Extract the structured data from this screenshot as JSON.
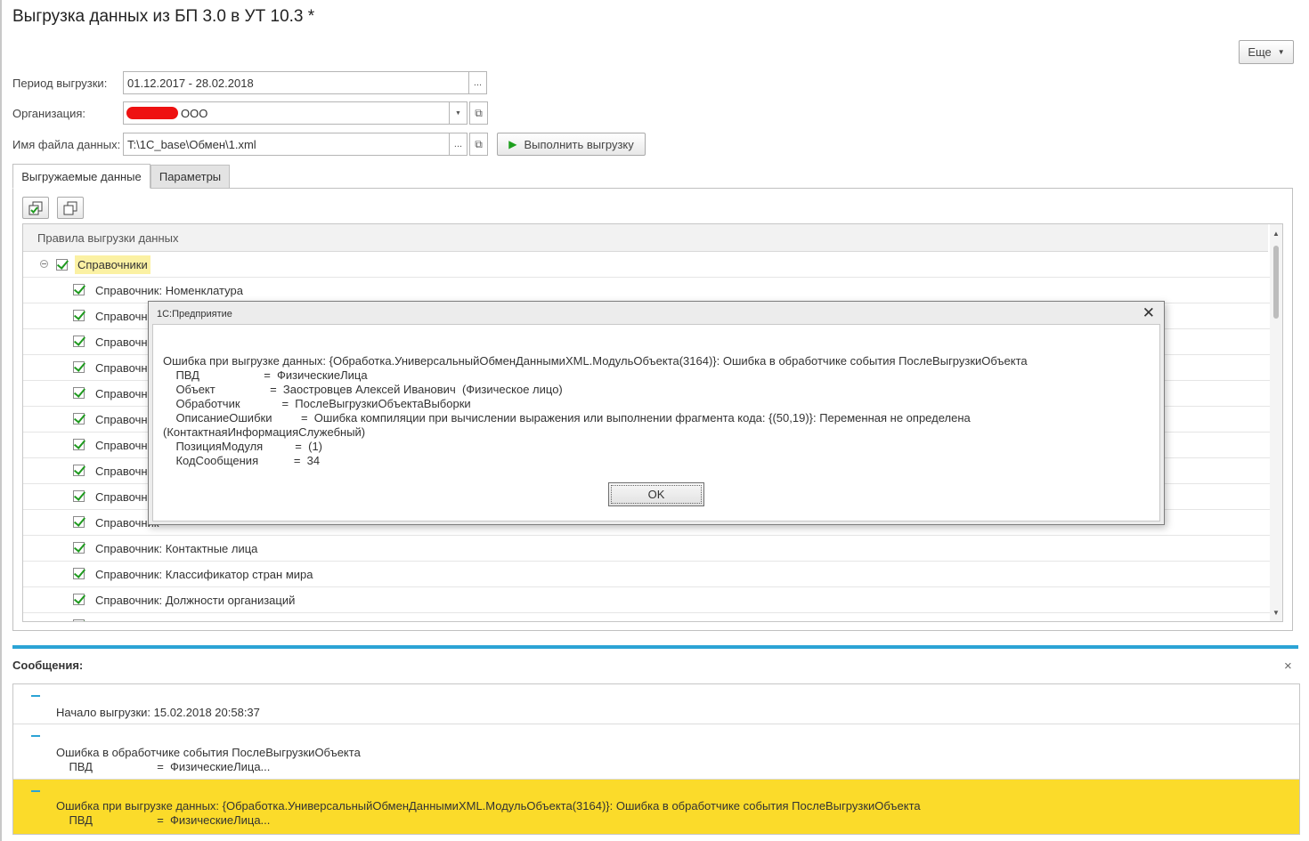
{
  "window": {
    "title": "Выгрузка данных из БП 3.0 в УТ 10.3 *"
  },
  "toolbar": {
    "more_label": "Еще",
    "more_caret": "▼"
  },
  "form": {
    "period_label": "Период выгрузки:",
    "period_value": "01.12.2017 - 28.02.2018",
    "org_label": "Организация:",
    "org_value": "ООО",
    "file_label": "Имя файла данных:",
    "file_value": "T:\\1C_base\\Обмен\\1.xml",
    "ellipsis": "...",
    "dropdown_caret": "▼",
    "open_glyph": "⧉",
    "run_label": "Выполнить выгрузку",
    "run_glyph": "▶"
  },
  "tabs": [
    {
      "label": "Выгружаемые данные",
      "active": true
    },
    {
      "label": "Параметры",
      "active": false
    }
  ],
  "tree": {
    "header": "Правила выгрузки данных",
    "root": "Справочники",
    "items": [
      "Справочник: Номенклатура",
      "Справочник",
      "Справочник",
      "Справочник",
      "Справочник",
      "Справочник",
      "Справочник",
      "Справочник",
      "Справочник",
      "Справочник",
      "Справочник: Контактные лица",
      "Справочник: Классификатор стран мира",
      "Справочник: Должности организаций"
    ]
  },
  "messages": {
    "title": "Сообщения:",
    "close_glyph": "×",
    "items": [
      {
        "lines": [
          "Начало выгрузки: 15.02.2018 20:58:37"
        ],
        "highlighted": false
      },
      {
        "lines": [
          "Ошибка в обработчике события ПослеВыгрузкиОбъекта",
          "    ПВД                    =  ФизическиеЛица..."
        ],
        "highlighted": false
      },
      {
        "lines": [
          "Ошибка при выгрузке данных: {Обработка.УниверсальныйОбменДаннымиXML.МодульОбъекта(3164)}: Ошибка в обработчике события ПослеВыгрузкиОбъекта",
          "    ПВД                    =  ФизическиеЛица..."
        ],
        "highlighted": true
      }
    ]
  },
  "dialog": {
    "title": "1С:Предприятие",
    "close_glyph": "✕",
    "lines": [
      "Ошибка при выгрузке данных: {Обработка.УниверсальныйОбменДаннымиXML.МодульОбъекта(3164)}: Ошибка в обработчике события ПослеВыгрузкиОбъекта",
      "    ПВД                    =  ФизическиеЛица",
      "    Объект                 =  Заостровцев Алексей Иванович  (Физическое лицо)",
      "    Обработчик             =  ПослеВыгрузкиОбъектаВыборки",
      "    ОписаниеОшибки         =  Ошибка компиляции при вычислении выражения или выполнении фрагмента кода: {(50,19)}: Переменная не определена",
      "(КонтактнаяИнформацияСлужебный)",
      "    ПозицияМодуля          =  (1)",
      "    КодСообщения           =  34"
    ],
    "ok_label": "OK"
  },
  "colors": {
    "accent": "#2ba3d5",
    "highlight_row": "#fbdb2a",
    "root_highlight": "#fbf1a3",
    "check": "#1f9a1f"
  }
}
